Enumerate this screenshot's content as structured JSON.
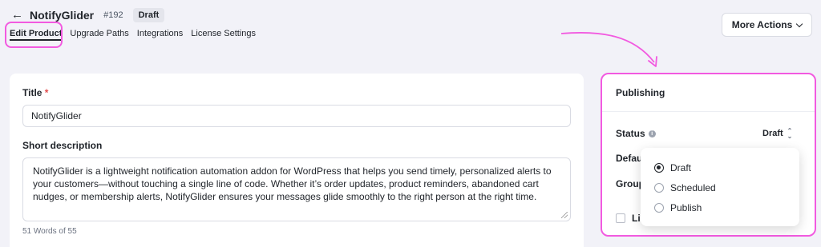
{
  "header": {
    "back_icon": "arrow-left-icon",
    "product_name": "NotifyGlider",
    "product_id": "#192",
    "status_badge": "Draft"
  },
  "tabs": [
    {
      "label": "Edit Product",
      "active": true
    },
    {
      "label": "Upgrade Paths"
    },
    {
      "label": "Integrations"
    },
    {
      "label": "License Settings"
    }
  ],
  "more_actions": {
    "label": "More Actions",
    "icon": "chevron-down-icon"
  },
  "form": {
    "title_label": "Title",
    "required_mark": "*",
    "title_value": "NotifyGlider",
    "short_desc_label": "Short description",
    "short_desc_value": "NotifyGlider is a lightweight notification automation addon for WordPress that helps you send timely, personalized alerts to your customers—without touching a single line of code. Whether it’s order updates, product reminders, abandoned cart nudges, or membership alerts, NotifyGlider ensures your messages glide smoothly to the right person at the right time.",
    "word_count": "51 Words of 55"
  },
  "publishing": {
    "title": "Publishing",
    "status_label": "Status",
    "status_value": "Draft",
    "default_label": "Defau",
    "group_label": "Group",
    "checkbox_label": "Lir"
  },
  "status_dropdown": {
    "options": [
      "Draft",
      "Scheduled",
      "Publish"
    ],
    "selected": "Draft"
  },
  "colors": {
    "annotation": "#f25ae0",
    "background": "#f2f2f8",
    "required": "#e24b4b"
  }
}
